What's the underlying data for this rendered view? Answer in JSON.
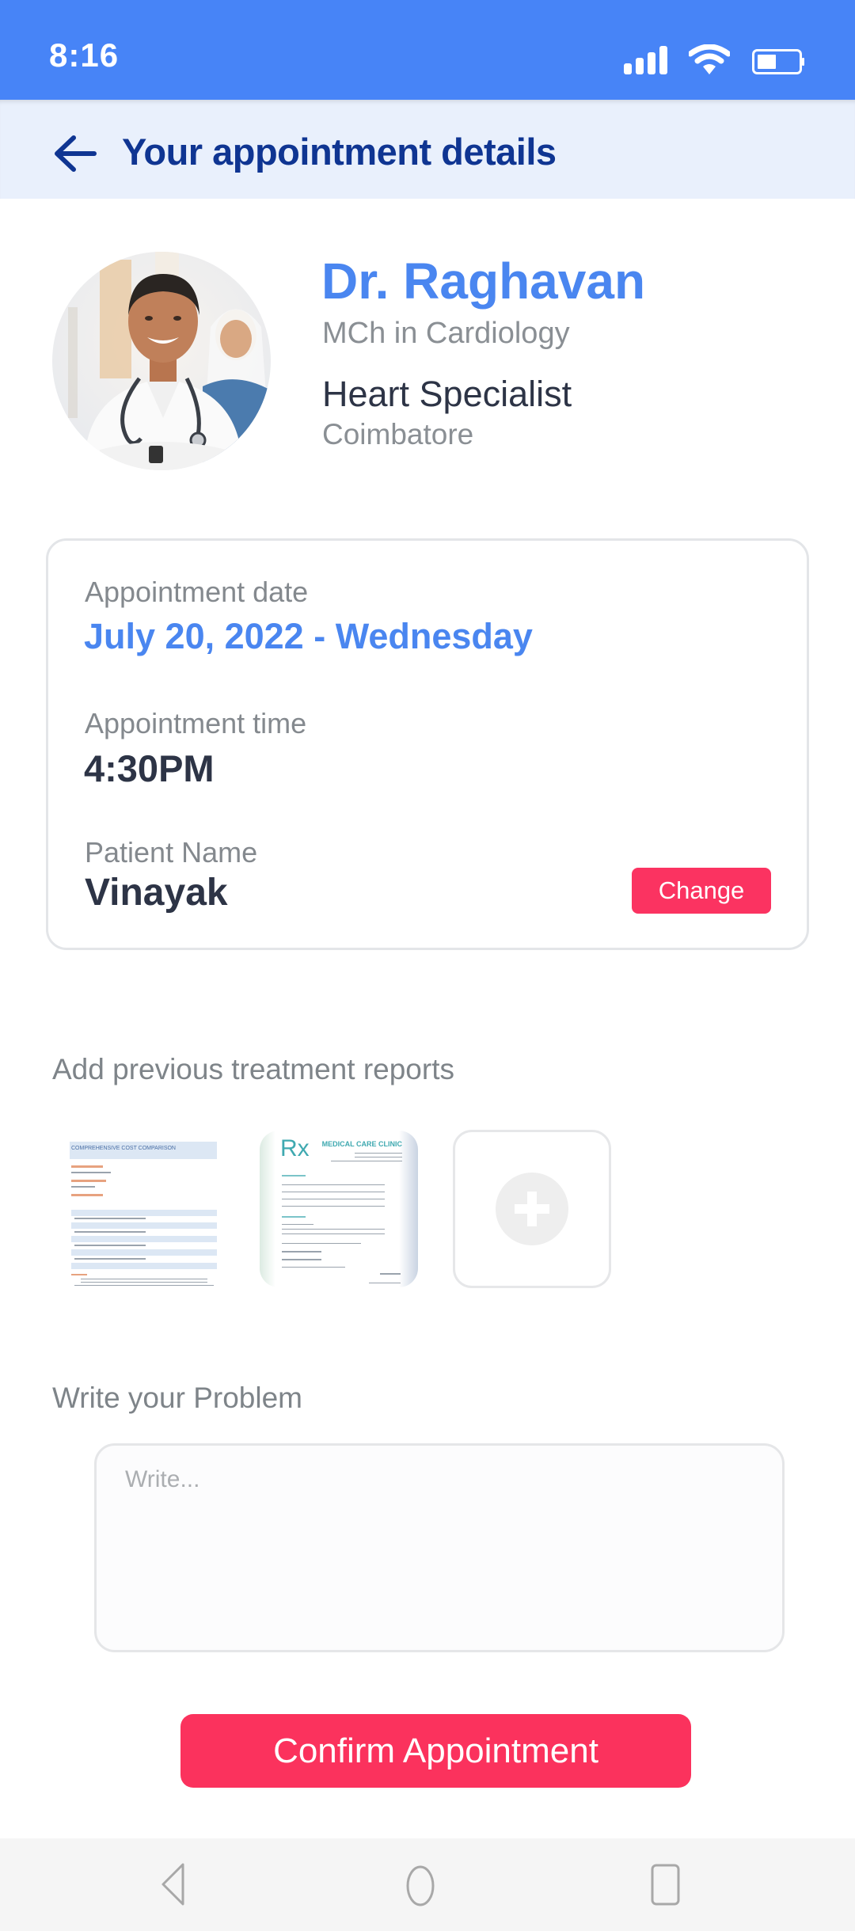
{
  "status_bar": {
    "time": "8:16",
    "icons": [
      "signal-icon",
      "wifi-icon",
      "battery-icon"
    ],
    "battery_level": 0.45
  },
  "header": {
    "back_icon": "arrow-left-icon",
    "title": "Your appointment details"
  },
  "doctor": {
    "name": "Dr. Raghavan",
    "degree": "MCh in Cardiology",
    "specialty": "Heart Specialist",
    "location": "Coimbatore"
  },
  "appointment": {
    "date_label": "Appointment date",
    "date_value": "July 20, 2022 - Wednesday",
    "time_label": "Appointment time",
    "time_value": "4:30PM",
    "patient_label": "Patient Name",
    "patient_value": "Vinayak",
    "change_label": "Change"
  },
  "reports": {
    "label": "Add previous treatment reports",
    "items": [
      {
        "title": "COMPREHENSIVE COST COMPARISON"
      },
      {
        "title": "MEDICAL CARE CLINIC",
        "symbol": "Rx"
      }
    ],
    "add_icon": "plus-icon"
  },
  "problem": {
    "label": "Write your Problem",
    "placeholder": "Write...",
    "value": ""
  },
  "confirm": {
    "label": "Confirm Appointment"
  },
  "nav_bar": {
    "icons": [
      "nav-back-icon",
      "nav-home-icon",
      "nav-recents-icon"
    ]
  },
  "colors": {
    "primary_blue": "#4784F7",
    "header_title": "#0F3592",
    "accent_red": "#FB325D",
    "doctor_name": "#4A86F0"
  }
}
